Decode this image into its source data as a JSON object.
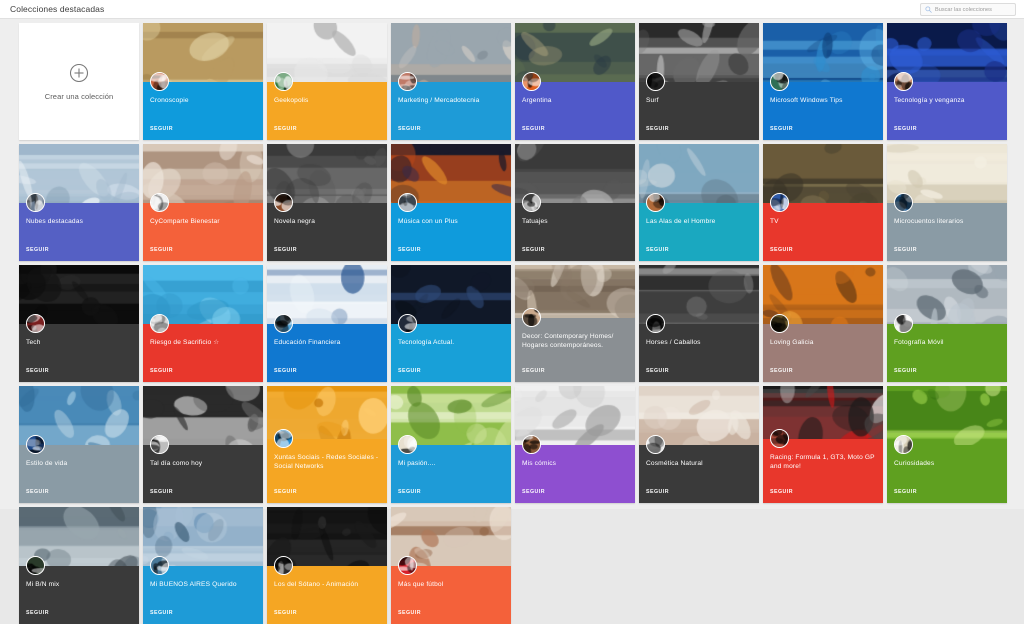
{
  "header": {
    "title": "Colecciones destacadas",
    "search": {
      "placeholder": "Buscar las colecciones",
      "value": "",
      "icon": "search-icon"
    }
  },
  "create_card": {
    "label": "Crear una colección",
    "icon": "plus-circle-icon"
  },
  "follow_label": "SEGUIR",
  "colors": {
    "page_background": "#eeeeee",
    "topbar_background": "#ffffff",
    "card_white": "#ffffff",
    "blue": "#0f9bdc",
    "orange": "#f5a623",
    "indigo": "#5059c9",
    "dark": "#3a3a3a",
    "red": "#e8372c",
    "green": "#5fa020",
    "teal": "#1aa8c0",
    "purple": "#8e4fd0",
    "slate": "#8a9ba5",
    "mauve": "#9d7d77",
    "deep_orange": "#f4613a"
  },
  "cards": [
    {
      "title": "Cronoscopie",
      "band": "#0f9bdc",
      "photo": "ancient-mosaic",
      "avatar": "#c8623e"
    },
    {
      "title": "Geekopolis",
      "band": "#f5a623",
      "photo": "tools-collage",
      "avatar": "#2f7a3e"
    },
    {
      "title": "Marketing / Mercadotecnia",
      "band": "#1e9bd7",
      "photo": "office-people",
      "avatar": "#c07a68"
    },
    {
      "title": "Argentina",
      "band": "#5059c9",
      "photo": "mountain-landscape",
      "avatar": "#e06020"
    },
    {
      "title": "Surf",
      "band": "#3a3a3a",
      "photo": "surfer-bw",
      "avatar": "#2b2b2b"
    },
    {
      "title": "Microsoft Windows Tips",
      "band": "#1078d0",
      "photo": "blue-desktop",
      "avatar": "#2f6f55"
    },
    {
      "title": "Tecnología y venganza",
      "band": "#5059c9",
      "photo": "neon-abstract",
      "avatar": "#c98a6a"
    },
    {
      "title": "Nubes destacadas",
      "band": "#5560c4",
      "photo": "clouds-sky",
      "avatar": "#6d7e92"
    },
    {
      "title": "CyComparte Bienestar",
      "band": "#f4613a",
      "photo": "mother-baby-yoga",
      "avatar": "#f0f0f0"
    },
    {
      "title": "Novela negra",
      "band": "#3a3a3a",
      "photo": "vintage-portrait-bw",
      "avatar": "#8a4a28"
    },
    {
      "title": "Música con un Plus",
      "band": "#0f9bdc",
      "photo": "concert-crowd",
      "avatar": "#6b7b8c"
    },
    {
      "title": "Tatuajes",
      "band": "#3a3a3a",
      "photo": "tattoo-arm-bw",
      "avatar": "#3b3b3b"
    },
    {
      "title": "Las Alas de el Hombre",
      "band": "#1aa8c0",
      "photo": "jet-front",
      "avatar": "#b06a3a"
    },
    {
      "title": "TV",
      "band": "#e8372c",
      "photo": "walking-dead-scene",
      "avatar": "#2f5aa8"
    },
    {
      "title": "Microcuentos literarios",
      "band": "#8a9ba5",
      "photo": "old-document",
      "avatar": "#2f6fa8"
    },
    {
      "title": "Tech",
      "band": "#3a3a3a",
      "photo": "ascii-terminal",
      "avatar": "#7a1f1f"
    },
    {
      "title": "Riesgo de Sacrificio ☆",
      "band": "#e8372c",
      "photo": "cartoon-sky",
      "avatar": "#d8d8d8"
    },
    {
      "title": "Educación Financiera",
      "band": "#1078d0",
      "photo": "bank-infographic",
      "avatar": "#4fa3d8"
    },
    {
      "title": "Tecnología Actual.",
      "band": "#18a0d8",
      "photo": "graduation-tech",
      "avatar": "#222a3a"
    },
    {
      "title": "Decor: Contemporary Homes/ Hogares contemporáneos.",
      "band": "#8a8f93",
      "photo": "living-room",
      "avatar": "#caa98c"
    },
    {
      "title": "Horses / Caballos",
      "band": "#3a3a3a",
      "photo": "horses-field-bw",
      "avatar": "#3a3a3a"
    },
    {
      "title": "Loving Galicia",
      "band": "#9d7d77",
      "photo": "sunset-trees",
      "avatar": "#6b5a2a"
    },
    {
      "title": "Fotografía Móvil",
      "band": "#5fa020",
      "photo": "cathedral-dome",
      "avatar": "#e8e8e8"
    },
    {
      "title": "Estilo de vida",
      "band": "#8a9ba5",
      "photo": "yacht-sea",
      "avatar": "#1f4a8a"
    },
    {
      "title": "Tal día como hoy",
      "band": "#3a3a3a",
      "photo": "bare-tree-snow",
      "avatar": "#bdbdbd"
    },
    {
      "title": "Xuntas Sociais - Redes Sociales - Social Networks",
      "band": "#f5a623",
      "photo": "social-networks-banner",
      "avatar": "#1f8ad0"
    },
    {
      "title": "Mi pasión....",
      "band": "#1e9bd7",
      "photo": "green-glass-orbs",
      "avatar": "#e8e0d0"
    },
    {
      "title": "Mis cómics",
      "band": "#8e4fd0",
      "photo": "comic-strips",
      "avatar": "#8a5a3a"
    },
    {
      "title": "Cosmética Natural",
      "band": "#3a3a3a",
      "photo": "cosmetic-powder",
      "avatar": "#ececec"
    },
    {
      "title": "Racing: Formula 1, GT3, Moto GP and more!",
      "band": "#e8372c",
      "photo": "race-car",
      "avatar": "#b04a3a"
    },
    {
      "title": "Curiosidades",
      "band": "#5fa020",
      "photo": "green-lizard",
      "avatar": "#d8d0b8"
    },
    {
      "title": "Mi B/N mix",
      "band": "#3a3a3a",
      "photo": "statue-bw",
      "avatar": "#2a3a2a"
    },
    {
      "title": "Mi BUENOS AIRES Querido",
      "band": "#1e9bd7",
      "photo": "city-skyline",
      "avatar": "#4a7a9a"
    },
    {
      "title": "Los del Sótano - Animación",
      "band": "#f5a623",
      "photo": "sotano-banner",
      "avatar": "#2a2a2a"
    },
    {
      "title": "Más que fútbol",
      "band": "#f4613a",
      "photo": "runners-legs",
      "avatar": "#d81f2a"
    }
  ]
}
